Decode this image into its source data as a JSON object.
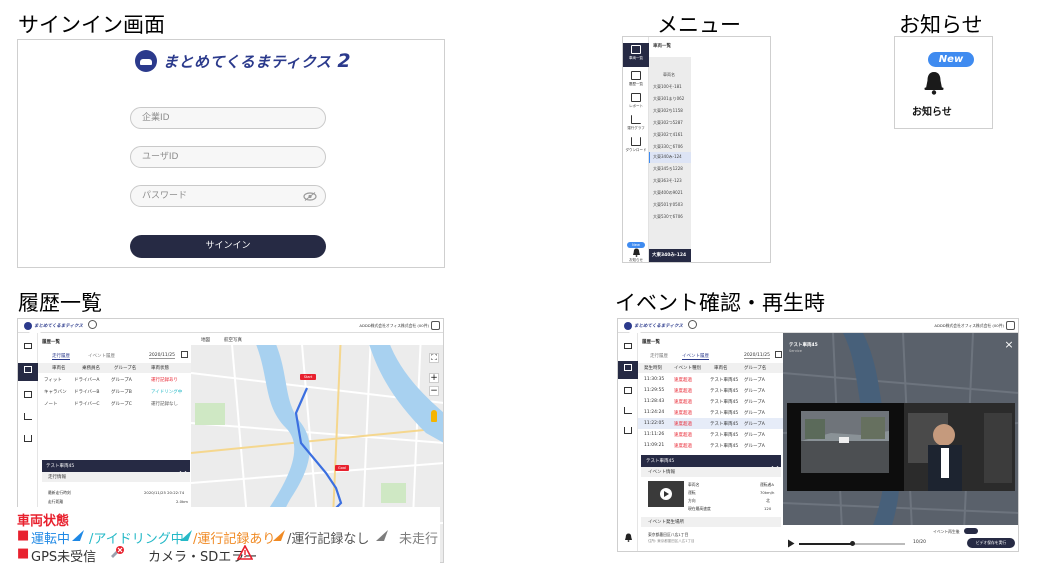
{
  "sections": {
    "signin_title": "サインイン画面",
    "menu_title": "メニュー",
    "notice_title": "お知らせ",
    "history_title": "履歴一覧",
    "event_title": "イベント確認・再生時"
  },
  "signin": {
    "logo_text": "まとめてくるまティクス",
    "logo_number": "2",
    "company_placeholder": "企業ID",
    "user_placeholder": "ユーザID",
    "password_placeholder": "パスワード",
    "signin_label": "サインイン"
  },
  "menu": {
    "side_items": [
      {
        "label": "車両一覧",
        "icon": "vehicle-list-icon"
      },
      {
        "label": "履歴一覧",
        "icon": "history-icon"
      },
      {
        "label": "レポート",
        "icon": "report-icon"
      },
      {
        "label": "運行グラフ",
        "icon": "graph-icon"
      },
      {
        "label": "ダウンロード",
        "icon": "download-icon"
      }
    ],
    "notice_label": "お知らせ",
    "list_header": "車両一覧",
    "list_column": "車両名",
    "vehicles": [
      "大東100そ-181",
      "大東301まり062",
      "大東302ち1158",
      "大東302つ5287",
      "大東302て4161",
      "大東330こ6706",
      "大東340み-124",
      "大東345ろ1228",
      "大東363そ-123",
      "大東400の9021",
      "大東501す0503",
      "大東530て6706"
    ],
    "selected_vehicle": "大東340み-124",
    "new_badge": "New"
  },
  "notice": {
    "new_badge": "New",
    "label": "お知らせ"
  },
  "history": {
    "page_title": "履歴一覧",
    "tab_active": "走行履歴",
    "tab_inactive": "イベント履歴",
    "date": "2020/11/25",
    "columns": [
      "車両名",
      "乗務員名",
      "グループ名",
      "車両状態"
    ],
    "rows": [
      [
        "フィット",
        "ドライバーA",
        "グループA",
        "運行記録あり"
      ],
      [
        "キャラバン",
        "ドライバーB",
        "グループB",
        "アイドリング中"
      ],
      [
        "ノート",
        "ドライバーC",
        "グループC",
        "運行記録なし"
      ]
    ],
    "map_tab_map": "地図",
    "map_tab_aerial": "航空写真",
    "company": "ADDD株式会社オフィス株式会社 (00件)",
    "detail_title": "テスト車両45",
    "detail_sub": "走行情報",
    "detail_row1_label": "最新走行時刻",
    "detail_row1_value": "2020/11/25 20:22:74",
    "detail_row2_label": "走行距離",
    "detail_row2_value": "2.0km",
    "map_pin_start": "Start",
    "map_pin_goal": "Goal"
  },
  "legend": {
    "heading": "車両状態",
    "driving": "運転中",
    "idling": "/アイドリング中",
    "recorded": "/運行記録あり",
    "not_recorded": "/運行記録なし",
    "not_driving": "未走行",
    "gps": "GPS未受信",
    "camera": "カメラ・SDエラー"
  },
  "event": {
    "page_title": "履歴一覧",
    "tab_inactive": "走行履歴",
    "tab_active": "イベント履歴",
    "date": "2020/11/25",
    "columns": [
      "発生時刻",
      "イベント種別",
      "車両名",
      "グループ名"
    ],
    "rows": [
      [
        "11:30:35",
        "速度超過",
        "テスト車両45",
        "グループA"
      ],
      [
        "11:29:55",
        "速度超過",
        "テスト車両45",
        "グループA"
      ],
      [
        "11:28:43",
        "速度超過",
        "テスト車両45",
        "グループA"
      ],
      [
        "11:24:24",
        "速度超過",
        "テスト車両45",
        "グループA"
      ],
      [
        "11:22:05",
        "速度超過",
        "テスト車両45",
        "グループA"
      ],
      [
        "11:11:26",
        "速度超過",
        "テスト車両45",
        "グループA"
      ],
      [
        "11:09:21",
        "速度超過",
        "テスト車両45",
        "グループA"
      ]
    ],
    "detail_title": "テスト車両45",
    "info_header": "イベント情報",
    "info_labels": [
      "車両名",
      "運転",
      "方向",
      "現在最高速度"
    ],
    "info_values": [
      "運転者A",
      "70km/h",
      "北",
      "120"
    ],
    "location_header": "イベント発生場所",
    "location_text": "東京都墨田区八広1丁目",
    "location_sub": "住所: 東京都墨田区八広1丁目",
    "video_title": "テスト車両45",
    "video_sub": "Service",
    "time_display": "10/20",
    "event_setting": "イベント再生後",
    "save_button": "ビデオ保存を実行",
    "company": "ADDD株式会社オフィス株式会社 (00件)"
  },
  "colors": {
    "brand": "#2b3a8c",
    "button_dark": "#262a44",
    "legend_red": "#e8212e",
    "legend_blue": "#1e88e5",
    "legend_teal": "#25b9c7",
    "legend_orange": "#f08a24",
    "legend_gray": "#7d7d7d",
    "new_badge": "#3f8bf0"
  }
}
